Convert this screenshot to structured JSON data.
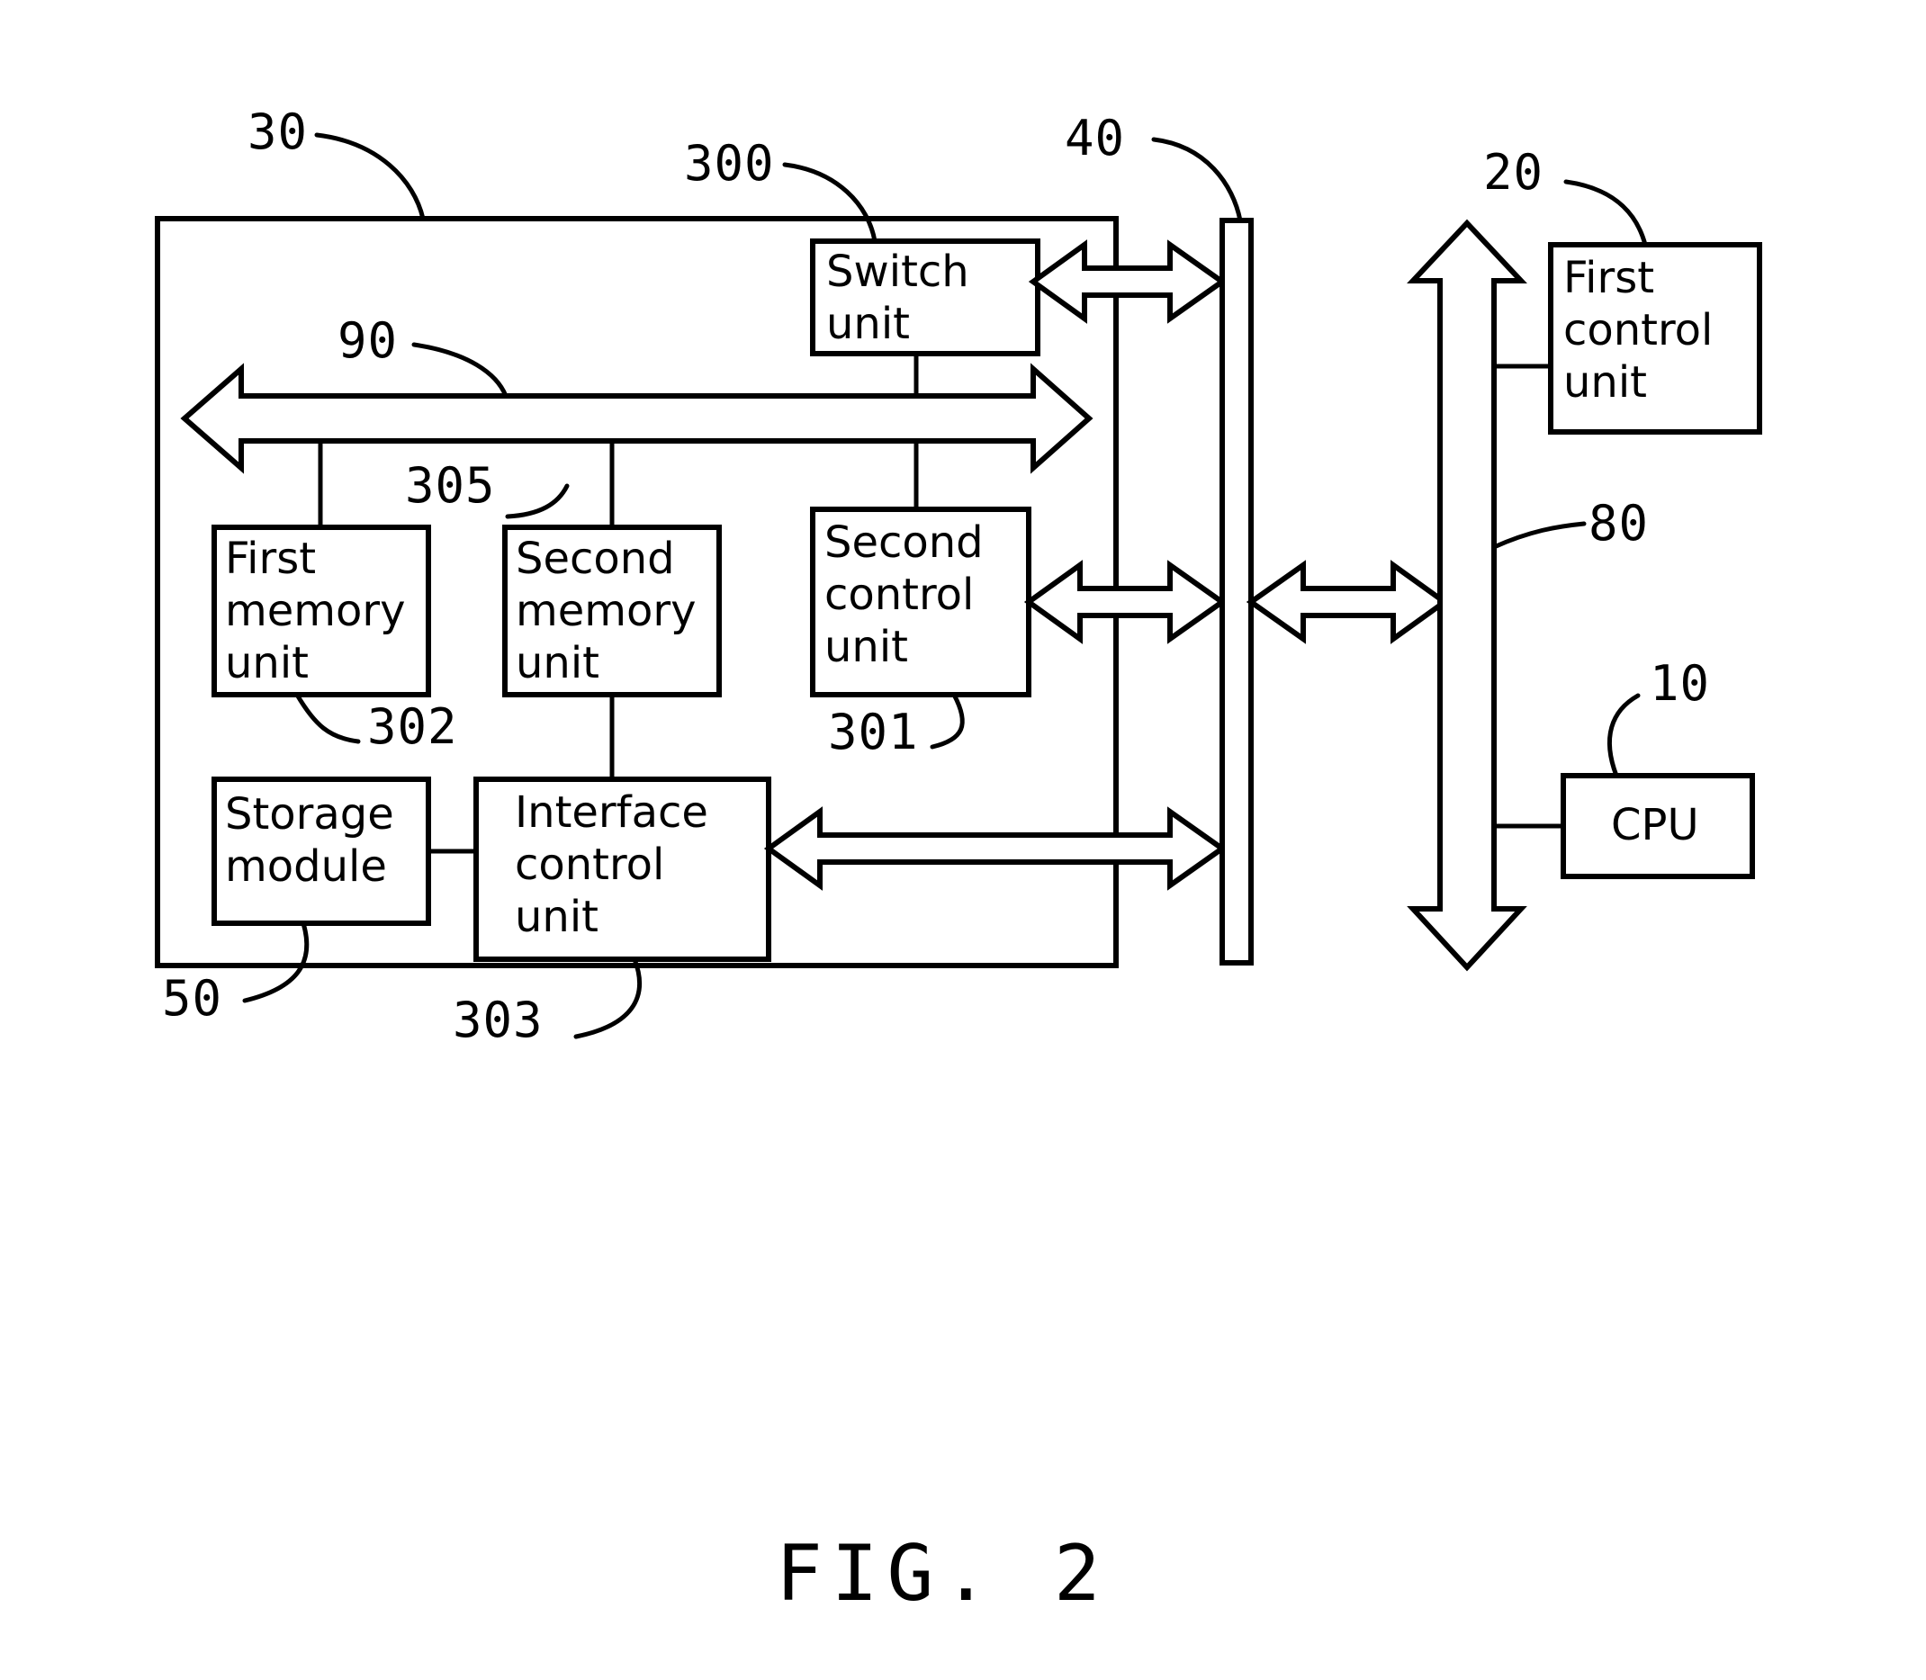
{
  "figure": {
    "caption": "FIG. 2",
    "type": "patent-block-diagram"
  },
  "blocks": {
    "switch_unit": {
      "line1": "Switch",
      "line2": "unit",
      "ref": "300"
    },
    "first_memory_unit": {
      "line1": "First",
      "line2": "memory",
      "line3": "unit",
      "ref": "302"
    },
    "second_memory_unit": {
      "line1": "Second",
      "line2": "memory",
      "line3": "unit",
      "ref": "305"
    },
    "second_control_unit": {
      "line1": "Second",
      "line2": "control",
      "line3": "unit",
      "ref": "301"
    },
    "storage_module": {
      "line1": "Storage",
      "line2": "module",
      "ref": "50"
    },
    "interface_control_unit": {
      "line1": "Interface",
      "line2": "control",
      "line3": "unit",
      "ref": "303"
    },
    "first_control_unit": {
      "line1": "First",
      "line2": "control",
      "line3": "unit",
      "ref": "20"
    },
    "cpu": {
      "line1": "CPU",
      "ref": "10"
    }
  },
  "refs": {
    "outer_enclosure": "30",
    "internal_bus": "90",
    "connector_bar": "40",
    "external_bus": "80",
    "switch_unit": "300",
    "second_control_unit": "301",
    "first_memory_unit": "302",
    "interface_control_unit": "303",
    "second_memory_unit": "305",
    "storage_module": "50",
    "first_control_unit": "20",
    "cpu": "10"
  },
  "colors": {
    "stroke": "#000000",
    "fill": "#ffffff",
    "background": "#ffffff"
  }
}
